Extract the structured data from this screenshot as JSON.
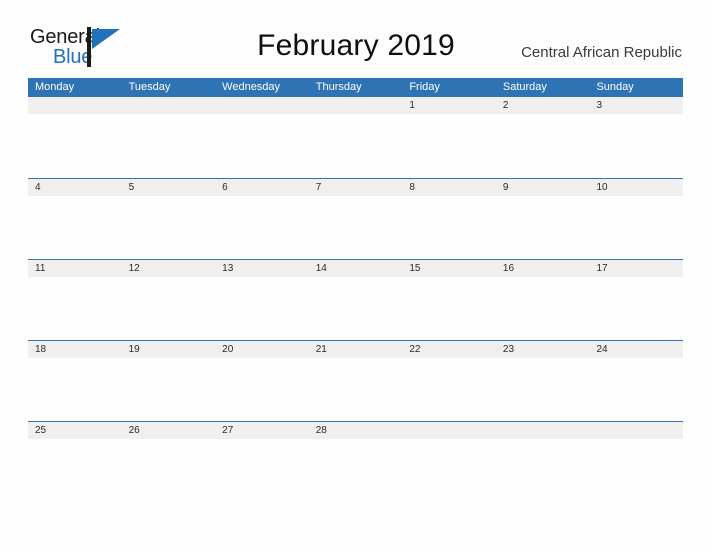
{
  "logo": {
    "word_top": "General",
    "word_bottom": "Blue",
    "mark_icon": "triangle-flag-icon",
    "accent_color": "#2272bb",
    "text_color": "#1b1b1b"
  },
  "header": {
    "title": "February 2019",
    "region": "Central African Republic"
  },
  "calendar": {
    "header_bg": "#2e73b4",
    "band_bg": "#efefef",
    "rule_color": "#2e73b4",
    "weekdays": [
      "Monday",
      "Tuesday",
      "Wednesday",
      "Thursday",
      "Friday",
      "Saturday",
      "Sunday"
    ],
    "weeks": [
      [
        "",
        "",
        "",
        "",
        "1",
        "2",
        "3"
      ],
      [
        "4",
        "5",
        "6",
        "7",
        "8",
        "9",
        "10"
      ],
      [
        "11",
        "12",
        "13",
        "14",
        "15",
        "16",
        "17"
      ],
      [
        "18",
        "19",
        "20",
        "21",
        "22",
        "23",
        "24"
      ],
      [
        "25",
        "26",
        "27",
        "28",
        "",
        "",
        ""
      ]
    ]
  }
}
